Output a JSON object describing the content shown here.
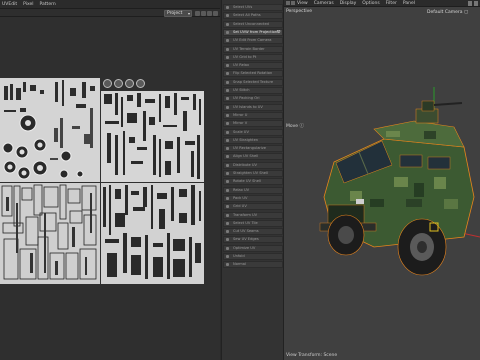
{
  "uv_editor": {
    "menu": [
      "UVEdit",
      "Pixel",
      "Pattern"
    ],
    "mode_select": "Project"
  },
  "commands": [
    {
      "label": "Select UVs",
      "active": false
    },
    {
      "label": "Select All Paths",
      "active": false
    },
    {
      "label": "Select Unconnected",
      "active": false
    },
    {
      "label": "Set UVW from Projection",
      "active": true
    },
    {
      "label": "UV Edit From Camera",
      "active": false
    },
    {
      "label": "UV Terrain Border",
      "active": false
    },
    {
      "label": "UV Grid to Pt",
      "active": false
    },
    {
      "label": "UV Relax",
      "active": false
    },
    {
      "label": "Flip Selected Rotation",
      "active": false
    },
    {
      "label": "Snap Selected Texture",
      "active": false
    },
    {
      "label": "UV Stitch",
      "active": false
    },
    {
      "label": "UV Packing Ori",
      "active": false
    },
    {
      "label": "UV Islands to UV",
      "active": false
    },
    {
      "label": "Mirror U",
      "active": false
    },
    {
      "label": "Mirror V",
      "active": false
    },
    {
      "label": "Scale UV",
      "active": false
    },
    {
      "label": "UV Straighten",
      "active": false
    },
    {
      "label": "UV Rectangularize",
      "active": false
    },
    {
      "label": "Align UV Shell",
      "active": false
    },
    {
      "label": "Distribute UV",
      "active": false
    },
    {
      "label": "Straighten UV Shell",
      "active": false
    },
    {
      "label": "Rotate UV Shell",
      "active": false
    },
    {
      "label": "Relax UV",
      "active": false
    },
    {
      "label": "Pack UV",
      "active": false
    },
    {
      "label": "Grid UV",
      "active": false
    },
    {
      "label": "Transform UV",
      "active": false
    },
    {
      "label": "Select UV Tile",
      "active": false
    },
    {
      "label": "Cut UV Seams",
      "active": false
    },
    {
      "label": "Sew UV Edges",
      "active": false
    },
    {
      "label": "Optimize UV",
      "active": false
    },
    {
      "label": "Unfold",
      "active": false
    },
    {
      "label": "Normal",
      "active": false
    }
  ],
  "viewport": {
    "menu": [
      "View",
      "Cameras",
      "Display",
      "Options",
      "Filter",
      "Panel"
    ],
    "projection_label": "Perspective",
    "camera_label": "Default Camera",
    "tool_label": "Move",
    "footer_label": "View Transform: Scene"
  },
  "colors": {
    "camo_dark": "#2f4a2a",
    "camo_mid": "#4c6a3a",
    "camo_light": "#6f8a4e",
    "selection_orange": "#e8841c",
    "uv_bg": "#d7d7d7"
  }
}
